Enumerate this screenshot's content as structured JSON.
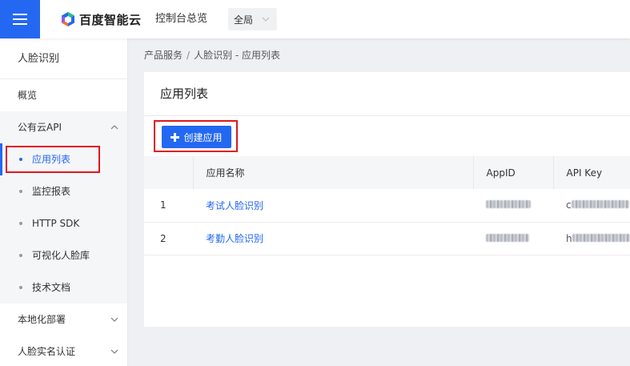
{
  "header": {
    "brand": "百度智能云",
    "console_label": "控制台总览",
    "region_value": "全局",
    "brand_colors": [
      "#2468f2",
      "#29c287",
      "#ff6b2c",
      "#8a5cf5"
    ]
  },
  "sidebar": {
    "title": "人脸识别",
    "overview": "概览",
    "group_public": "公有云API",
    "sub_items": [
      "应用列表",
      "监控报表",
      "HTTP SDK",
      "可视化人脸库",
      "技术文档"
    ],
    "group_local": "本地化部署",
    "group_realname": "人脸实名认证"
  },
  "breadcrumb": {
    "root": "产品服务",
    "sep": "/",
    "current": "人脸识别 - 应用列表"
  },
  "main": {
    "title": "应用列表",
    "create_label": "创建应用",
    "table": {
      "headers": [
        "",
        "应用名称",
        "AppID",
        "API Key"
      ],
      "rows": [
        {
          "index": "1",
          "name": "考试人脸识别",
          "key_prefix": "c"
        },
        {
          "index": "2",
          "name": "考勤人脸识别",
          "key_prefix": "h"
        }
      ]
    }
  },
  "colors": {
    "accent": "#2468f2",
    "highlight": "#e0161c"
  }
}
